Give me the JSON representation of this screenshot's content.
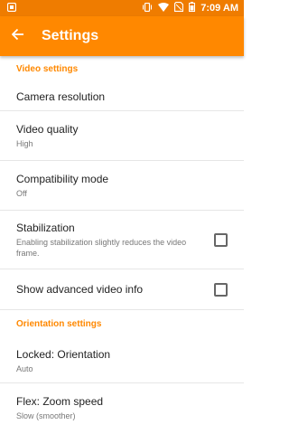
{
  "status_bar": {
    "time": "7:09 AM",
    "icons": [
      "notification-icon",
      "vibrate-icon",
      "wifi-icon",
      "no-sim-icon",
      "battery-icon"
    ]
  },
  "toolbar": {
    "title": "Settings",
    "back_icon": "arrow-back-icon"
  },
  "sections": {
    "video": {
      "header": "Video settings",
      "camera_resolution": {
        "title": "Camera resolution"
      },
      "video_quality": {
        "title": "Video quality",
        "value": "High"
      },
      "compatibility_mode": {
        "title": "Compatibility mode",
        "value": "Off"
      },
      "stabilization": {
        "title": "Stabilization",
        "summary": "Enabling stabilization slightly reduces the video frame.",
        "checked": false
      },
      "advanced_info": {
        "title": "Show advanced video info",
        "checked": false
      }
    },
    "orientation": {
      "header": "Orientation settings",
      "locked_orientation": {
        "title": "Locked: Orientation",
        "value": "Auto"
      },
      "zoom_speed": {
        "title": "Flex: Zoom speed",
        "value": "Slow (smoother)"
      }
    }
  },
  "colors": {
    "accent": "#ff8800",
    "statusbar": "#ef7c00"
  }
}
